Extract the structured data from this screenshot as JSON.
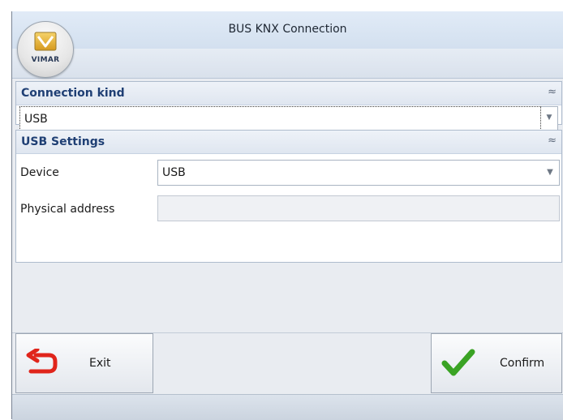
{
  "window": {
    "title": "BUS KNX Connection"
  },
  "app_button": {
    "brand_text": "VIMAR"
  },
  "connection_panel": {
    "title": "Connection kind",
    "collapse_icon": "double-chevron-up-icon",
    "selected_value": "USB"
  },
  "usb_panel": {
    "title": "USB Settings",
    "collapse_icon": "double-chevron-up-icon",
    "device_label": "Device",
    "device_value": "USB",
    "physical_address_label": "Physical address",
    "physical_address_value": ""
  },
  "buttons": {
    "exit_label": "Exit",
    "exit_icon": "undo-arrow-icon",
    "confirm_label": "Confirm",
    "confirm_icon": "checkmark-icon"
  },
  "colors": {
    "accent": "#1f3f74",
    "exit_icon": "#e0251b",
    "confirm_icon": "#3aa324"
  }
}
